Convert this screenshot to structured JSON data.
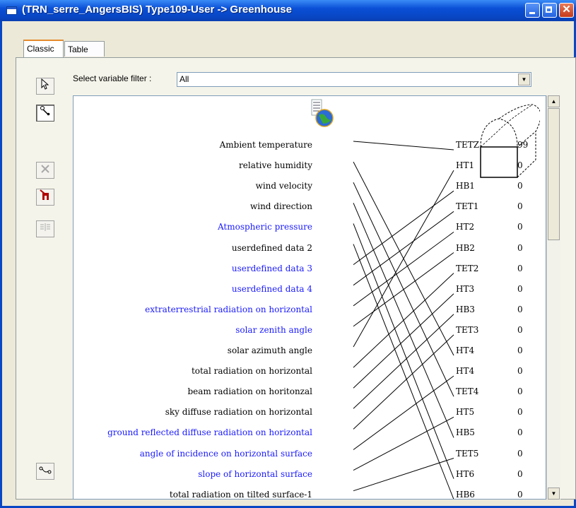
{
  "window": {
    "title": "(TRN_serre_AngersBIS) Type109-User -> Greenhouse",
    "close_glyph": "✕"
  },
  "tabs": [
    "Classic",
    "Table"
  ],
  "filter": {
    "label": "Select variable filter :",
    "value": "All"
  },
  "toolbar": [
    "pointer-icon",
    "link-icon",
    "delete-icon",
    "move-icon",
    "disabled-list-icon",
    "connector-icon"
  ],
  "inputs": [
    {
      "label": "Ambient temperature",
      "color": "#000000"
    },
    {
      "label": "relative humidity",
      "color": "#000000"
    },
    {
      "label": "wind velocity",
      "color": "#000000"
    },
    {
      "label": "wind direction",
      "color": "#000000"
    },
    {
      "label": "Atmospheric pressure",
      "color": "#1a1aff"
    },
    {
      "label": "userdefined data 2",
      "color": "#000000"
    },
    {
      "label": "userdefined data 3",
      "color": "#1a1aff"
    },
    {
      "label": "userdefined data 4",
      "color": "#1a1aff"
    },
    {
      "label": "extraterrestrial radiation on horizontal",
      "color": "#1a1aff"
    },
    {
      "label": "solar zenith angle",
      "color": "#1a1aff"
    },
    {
      "label": "solar azimuth angle",
      "color": "#000000"
    },
    {
      "label": "total radiation on horizontal",
      "color": "#000000"
    },
    {
      "label": "beam radiation on horitonzal",
      "color": "#000000"
    },
    {
      "label": "sky diffuse radiation on horizontal",
      "color": "#000000"
    },
    {
      "label": "ground reflected diffuse radiation on horizontal",
      "color": "#1a1aff"
    },
    {
      "label": "angle of incidence on horizontal surface",
      "color": "#1a1aff"
    },
    {
      "label": "slope of horizontal surface",
      "color": "#1a1aff"
    },
    {
      "label": "total radiation on tilted surface-1",
      "color": "#000000"
    }
  ],
  "outputs": [
    {
      "label": "TETZ",
      "value": "99"
    },
    {
      "label": "HT1",
      "value": "0"
    },
    {
      "label": "HB1",
      "value": "0"
    },
    {
      "label": "TET1",
      "value": "0"
    },
    {
      "label": "HT2",
      "value": "0"
    },
    {
      "label": "HB2",
      "value": "0"
    },
    {
      "label": "TET2",
      "value": "0"
    },
    {
      "label": "HT3",
      "value": "0"
    },
    {
      "label": "HB3",
      "value": "0"
    },
    {
      "label": "TET3",
      "value": "0"
    },
    {
      "label": "HT4",
      "value": "0"
    },
    {
      "label": "HT4",
      "value": "0"
    },
    {
      "label": "TET4",
      "value": "0"
    },
    {
      "label": "HT5",
      "value": "0"
    },
    {
      "label": "HB5",
      "value": "0"
    },
    {
      "label": "TET5",
      "value": "0"
    },
    {
      "label": "HT6",
      "value": "0"
    },
    {
      "label": "HB6",
      "value": "0"
    }
  ],
  "connections": [
    [
      0,
      0
    ],
    [
      1,
      10
    ],
    [
      2,
      12
    ],
    [
      3,
      14
    ],
    [
      4,
      16
    ],
    [
      5,
      17
    ],
    [
      6,
      2
    ],
    [
      7,
      3
    ],
    [
      8,
      4
    ],
    [
      9,
      5
    ],
    [
      10,
      1
    ],
    [
      11,
      6
    ],
    [
      12,
      7
    ],
    [
      13,
      8
    ],
    [
      14,
      9
    ],
    [
      15,
      11
    ],
    [
      16,
      13
    ],
    [
      17,
      15
    ]
  ]
}
